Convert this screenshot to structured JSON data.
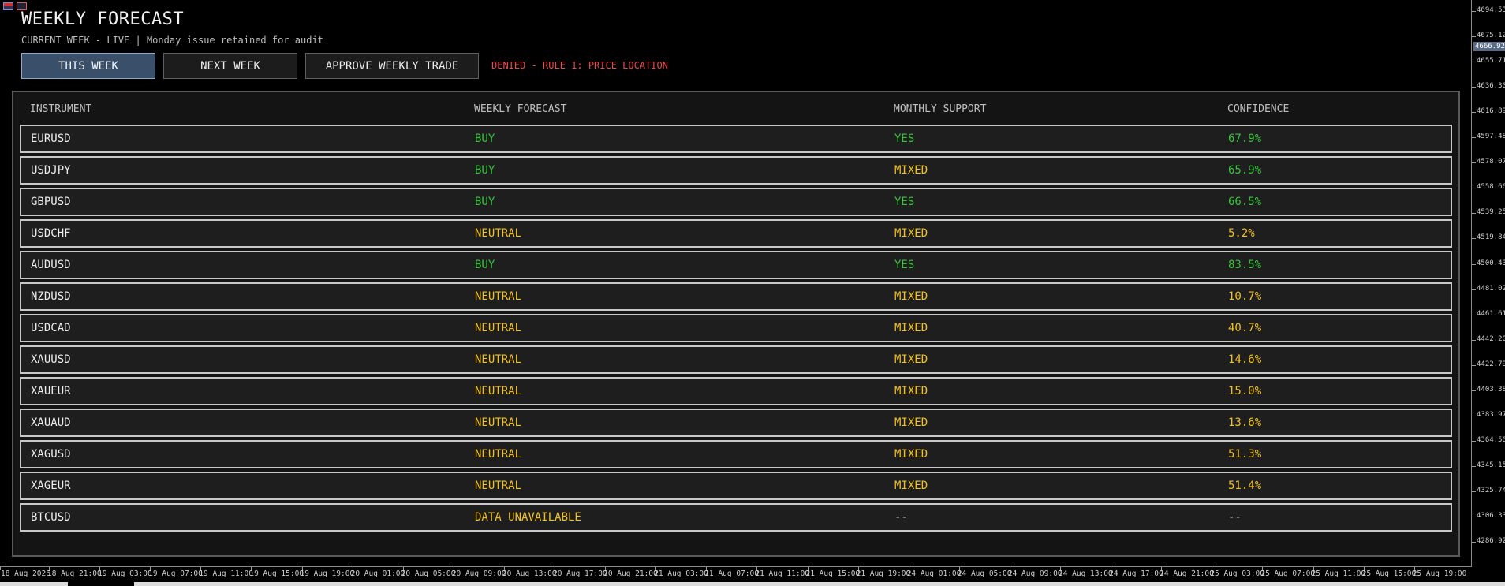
{
  "panel": {
    "title": "WEEKLY FORECAST",
    "subtitle": "CURRENT WEEK - LIVE | Monday issue retained for audit",
    "buttons": {
      "this_week": "THIS WEEK",
      "next_week": "NEXT WEEK",
      "approve": "APPROVE WEEKLY TRADE"
    },
    "status": "DENIED - RULE 1: PRICE LOCATION"
  },
  "table": {
    "headers": [
      "INSTRUMENT",
      "WEEKLY FORECAST",
      "MONTHLY SUPPORT",
      "CONFIDENCE"
    ],
    "rows": [
      {
        "instrument": "EURUSD",
        "forecast": "BUY",
        "support": "YES",
        "confidence": "67.9%",
        "forecast_color": "green",
        "support_color": "green",
        "confidence_color": "green"
      },
      {
        "instrument": "USDJPY",
        "forecast": "BUY",
        "support": "MIXED",
        "confidence": "65.9%",
        "forecast_color": "green",
        "support_color": "yellow",
        "confidence_color": "green"
      },
      {
        "instrument": "GBPUSD",
        "forecast": "BUY",
        "support": "YES",
        "confidence": "66.5%",
        "forecast_color": "green",
        "support_color": "green",
        "confidence_color": "green"
      },
      {
        "instrument": "USDCHF",
        "forecast": "NEUTRAL",
        "support": "MIXED",
        "confidence": "5.2%",
        "forecast_color": "yellow",
        "support_color": "yellow",
        "confidence_color": "yellow"
      },
      {
        "instrument": "AUDUSD",
        "forecast": "BUY",
        "support": "YES",
        "confidence": "83.5%",
        "forecast_color": "green",
        "support_color": "green",
        "confidence_color": "green"
      },
      {
        "instrument": "NZDUSD",
        "forecast": "NEUTRAL",
        "support": "MIXED",
        "confidence": "10.7%",
        "forecast_color": "yellow",
        "support_color": "yellow",
        "confidence_color": "yellow"
      },
      {
        "instrument": "USDCAD",
        "forecast": "NEUTRAL",
        "support": "MIXED",
        "confidence": "40.7%",
        "forecast_color": "yellow",
        "support_color": "yellow",
        "confidence_color": "yellow"
      },
      {
        "instrument": "XAUUSD",
        "forecast": "NEUTRAL",
        "support": "MIXED",
        "confidence": "14.6%",
        "forecast_color": "yellow",
        "support_color": "yellow",
        "confidence_color": "yellow"
      },
      {
        "instrument": "XAUEUR",
        "forecast": "NEUTRAL",
        "support": "MIXED",
        "confidence": "15.0%",
        "forecast_color": "yellow",
        "support_color": "yellow",
        "confidence_color": "yellow"
      },
      {
        "instrument": "XAUAUD",
        "forecast": "NEUTRAL",
        "support": "MIXED",
        "confidence": "13.6%",
        "forecast_color": "yellow",
        "support_color": "yellow",
        "confidence_color": "yellow"
      },
      {
        "instrument": "XAGUSD",
        "forecast": "NEUTRAL",
        "support": "MIXED",
        "confidence": "51.3%",
        "forecast_color": "yellow",
        "support_color": "yellow",
        "confidence_color": "yellow"
      },
      {
        "instrument": "XAGEUR",
        "forecast": "NEUTRAL",
        "support": "MIXED",
        "confidence": "51.4%",
        "forecast_color": "yellow",
        "support_color": "yellow",
        "confidence_color": "yellow"
      },
      {
        "instrument": "BTCUSD",
        "forecast": "DATA UNAVAILABLE",
        "support": "--",
        "confidence": "--",
        "forecast_color": "yellow",
        "support_color": "dim",
        "confidence_color": "dim"
      }
    ]
  },
  "price_axis": {
    "labels": [
      "4694.53",
      "4675.12",
      "4655.71",
      "4636.30",
      "4616.89",
      "4597.48",
      "4578.07",
      "4558.66",
      "4539.25",
      "4519.84",
      "4500.43",
      "4481.02",
      "4461.61",
      "4442.20",
      "4422.79",
      "4403.38",
      "4383.97",
      "4364.56",
      "4345.15",
      "4325.74",
      "4306.33",
      "4286.92"
    ],
    "current_price": "4666.92"
  },
  "time_axis": {
    "labels": [
      "18 Aug 2026",
      "18 Aug 21:00",
      "19 Aug 03:00",
      "19 Aug 07:00",
      "19 Aug 11:00",
      "19 Aug 15:00",
      "19 Aug 19:00",
      "20 Aug 01:00",
      "20 Aug 05:00",
      "20 Aug 09:00",
      "20 Aug 13:00",
      "20 Aug 17:00",
      "20 Aug 21:00",
      "21 Aug 03:00",
      "21 Aug 07:00",
      "21 Aug 11:00",
      "21 Aug 15:00",
      "21 Aug 19:00",
      "24 Aug 01:00",
      "24 Aug 05:00",
      "24 Aug 09:00",
      "24 Aug 13:00",
      "24 Aug 17:00",
      "24 Aug 21:00",
      "25 Aug 03:00",
      "25 Aug 07:00",
      "25 Aug 11:00",
      "25 Aug 15:00",
      "25 Aug 19:00"
    ]
  },
  "colors": {
    "green": "#35c43a",
    "yellow": "#f0c020",
    "red": "#ef4848",
    "active_button": "#3a4f6a"
  }
}
